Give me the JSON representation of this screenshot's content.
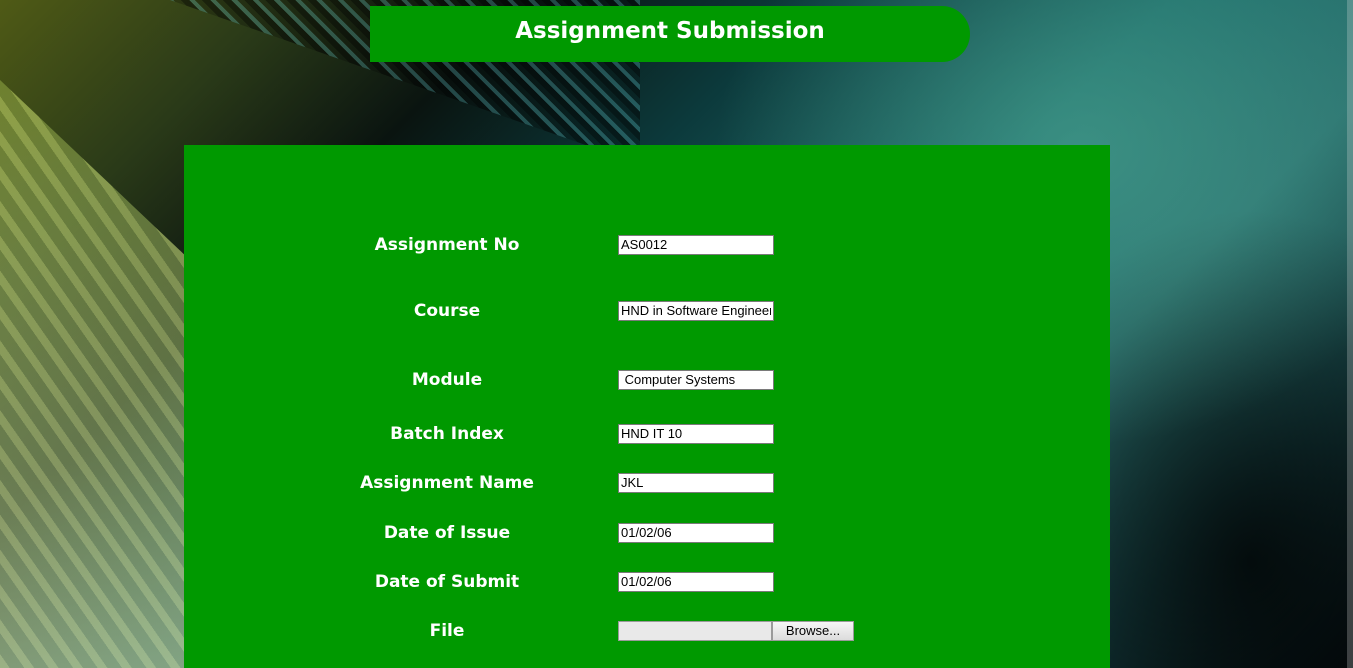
{
  "header": {
    "title": "Assignment Submission"
  },
  "form": {
    "fields": [
      {
        "label": "Assignment No",
        "value": "AS0012"
      },
      {
        "label": "Course",
        "value": "HND in Software Engineering"
      },
      {
        "label": "Module",
        "value": " Computer Systems"
      },
      {
        "label": "Batch Index",
        "value": "HND IT 10"
      },
      {
        "label": "Assignment Name",
        "value": "JKL"
      },
      {
        "label": "Date of Issue",
        "value": "01/02/06"
      },
      {
        "label": "Date of Submit",
        "value": "01/02/06"
      }
    ],
    "file": {
      "label": "File",
      "browse_label": "Browse..."
    }
  },
  "colors": {
    "panel": "#009900",
    "text": "#ffffff"
  }
}
